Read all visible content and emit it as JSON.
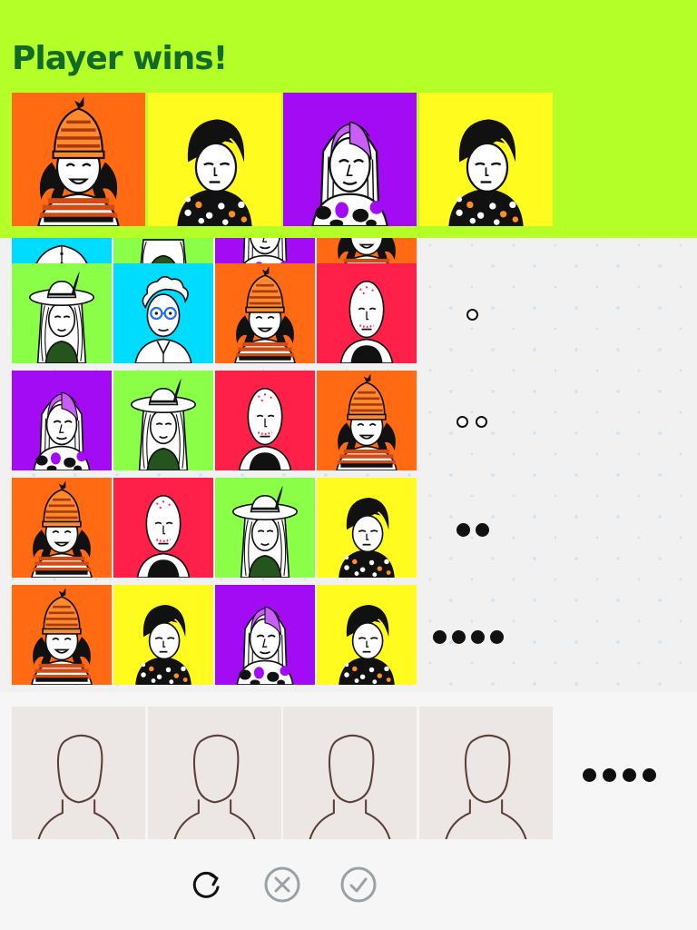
{
  "title": "Player wins!",
  "colors": {
    "banner_bg": "#b3ff27",
    "title_color": "#116a26",
    "board_bg": "#f1f1f1",
    "slot_bg": "#ece7e5",
    "disabled_icon": "#9aa1a4"
  },
  "secret_code": [
    "beanie-girl",
    "polka-woman",
    "purple-hair-woman",
    "polka-woman"
  ],
  "board": {
    "partial_row": [
      "white-shirt-man",
      "green-hat-woman",
      "purple-hair-woman",
      "beanie-girl"
    ],
    "rows": [
      {
        "guess": [
          "hat-woman",
          "curly-glasses-man",
          "beanie-girl",
          "bald-man"
        ],
        "feedback": [
          "white"
        ]
      },
      {
        "guess": [
          "purple-hair-woman",
          "hat-woman",
          "bald-man",
          "beanie-girl"
        ],
        "feedback": [
          "white",
          "white"
        ]
      },
      {
        "guess": [
          "beanie-girl",
          "bald-man",
          "hat-woman",
          "polka-woman"
        ],
        "feedback": [
          "black",
          "black"
        ]
      },
      {
        "guess": [
          "beanie-girl",
          "polka-woman",
          "purple-hair-woman",
          "polka-woman"
        ],
        "feedback": [
          "black",
          "black",
          "black",
          "black"
        ]
      }
    ]
  },
  "current_guess": {
    "slots": [
      "empty-silhouette",
      "empty-silhouette",
      "empty-silhouette",
      "empty-silhouette"
    ],
    "dots": 4
  },
  "controls": {
    "reset": "refresh-icon",
    "clear": "cancel-circle-icon",
    "submit": "check-circle-icon",
    "reset_enabled": true,
    "clear_enabled": false,
    "submit_enabled": false
  }
}
